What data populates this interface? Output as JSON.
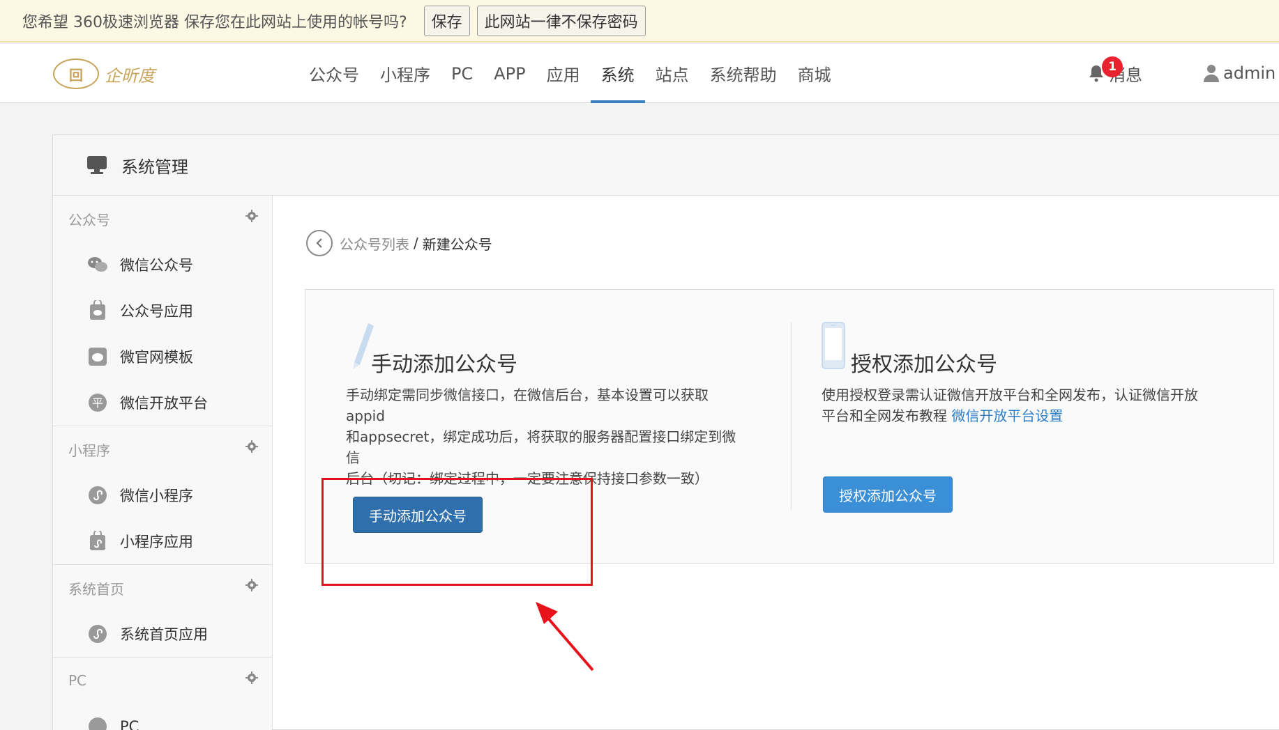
{
  "password_bar": {
    "message": "您希望 360极速浏览器 保存您在此网站上使用的帐号吗?",
    "save_label": "保存",
    "never_label": "此网站一律不保存密码"
  },
  "header": {
    "logo_mark": "回",
    "logo_text": "企昕度",
    "nav": [
      "公众号",
      "小程序",
      "PC",
      "APP",
      "应用",
      "系统",
      "站点",
      "系统帮助",
      "商城"
    ],
    "active_nav": "系统",
    "messages_label": "消息",
    "messages_badge": "1",
    "user_name": "admin"
  },
  "panel": {
    "title": "系统管理"
  },
  "sidebar": {
    "sections": [
      {
        "title": "公众号",
        "items": [
          "微信公众号",
          "公众号应用",
          "微官网模板",
          "微信开放平台"
        ]
      },
      {
        "title": "小程序",
        "items": [
          "微信小程序",
          "小程序应用"
        ]
      },
      {
        "title": "系统首页",
        "items": [
          "系统首页应用"
        ]
      },
      {
        "title": "PC",
        "items": [
          "PC"
        ]
      }
    ]
  },
  "breadcrumb": {
    "parent": "公众号列表",
    "separator": "/",
    "current": "新建公众号"
  },
  "manual": {
    "title": "手动添加公众号",
    "desc_line1": "手动绑定需同步微信接口，在微信后台，基本设置可以获取appid",
    "desc_line2": "和appsecret，绑定成功后，将获取的服务器配置接口绑定到微信",
    "desc_line3": "后台（切记：绑定过程中，一定要注意保持接口参数一致）",
    "button_label": "手动添加公众号"
  },
  "authorize": {
    "title": "授权添加公众号",
    "desc_line1": "使用授权登录需认证微信开放平台和全网发布，认证微信开放",
    "desc_line2_prefix": "平台和全网发布教程 ",
    "desc_link": "微信开放平台设置",
    "button_label": "授权添加公众号"
  },
  "colors": {
    "primary_dark": "#2f6fab",
    "primary_light": "#3a8fd6",
    "highlight": "#e8121b",
    "active_tab": "#3a7fbf"
  }
}
